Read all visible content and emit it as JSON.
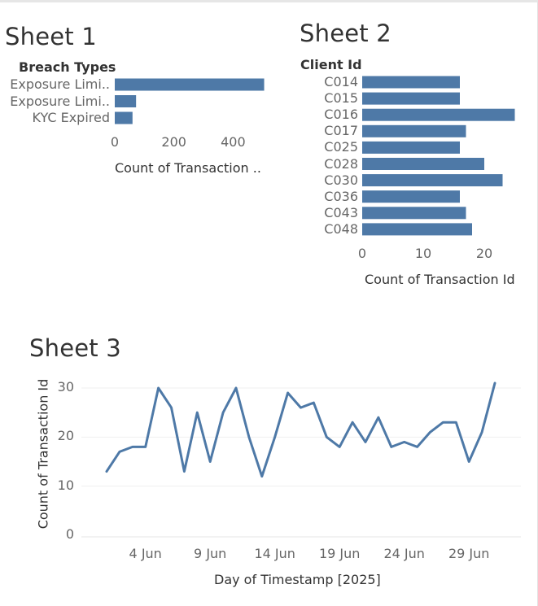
{
  "sheets": [
    {
      "title": "Sheet 1"
    },
    {
      "title": "Sheet 2"
    },
    {
      "title": "Sheet 3"
    }
  ],
  "colors": {
    "mark": "#4e79a7",
    "grid": "#efefef",
    "axis_text": "#666666",
    "title_text": "#333333"
  },
  "chart_data": [
    {
      "type": "bar",
      "orientation": "horizontal",
      "title": "Sheet 1",
      "row_header": "Breach Types",
      "categories": [
        "Exposure Limi..",
        "Exposure Limi..",
        "KYC Expired"
      ],
      "values": [
        505,
        72,
        60
      ],
      "xlabel": "Count of Transaction ..",
      "xticks": [
        "0",
        "200",
        "400"
      ],
      "xlim": [
        0,
        520
      ]
    },
    {
      "type": "bar",
      "orientation": "horizontal",
      "title": "Sheet 2",
      "row_header": "Client Id",
      "categories": [
        "C014",
        "C015",
        "C016",
        "C017",
        "C025",
        "C028",
        "C030",
        "C036",
        "C043",
        "C048"
      ],
      "values": [
        16,
        16,
        25,
        17,
        16,
        20,
        23,
        16,
        17,
        18
      ],
      "xlabel": "Count of Transaction Id",
      "xticks": [
        "0",
        "10",
        "20"
      ],
      "xlim": [
        0,
        26
      ]
    },
    {
      "type": "line",
      "title": "Sheet 3",
      "xlabel": "Day of Timestamp [2025]",
      "ylabel": "Count of Transaction Id",
      "yticks": [
        "0",
        "10",
        "20",
        "30"
      ],
      "ylim": [
        0,
        32
      ],
      "xticks": [
        {
          "label": "4 Jun",
          "day": 4
        },
        {
          "label": "9 Jun",
          "day": 9
        },
        {
          "label": "14 Jun",
          "day": 14
        },
        {
          "label": "19 Jun",
          "day": 19
        },
        {
          "label": "24 Jun",
          "day": 24
        },
        {
          "label": "29 Jun",
          "day": 29
        }
      ],
      "x": [
        "2025-06-01",
        "2025-06-02",
        "2025-06-03",
        "2025-06-04",
        "2025-06-05",
        "2025-06-06",
        "2025-06-07",
        "2025-06-08",
        "2025-06-09",
        "2025-06-10",
        "2025-06-11",
        "2025-06-12",
        "2025-06-13",
        "2025-06-14",
        "2025-06-15",
        "2025-06-16",
        "2025-06-17",
        "2025-06-18",
        "2025-06-19",
        "2025-06-20",
        "2025-06-21",
        "2025-06-22",
        "2025-06-23",
        "2025-06-24",
        "2025-06-25",
        "2025-06-26",
        "2025-06-27",
        "2025-06-28",
        "2025-06-29",
        "2025-06-30",
        "2025-07-01"
      ],
      "values": [
        13,
        17,
        18,
        18,
        30,
        26,
        13,
        25,
        15,
        25,
        30,
        20,
        12,
        20,
        29,
        26,
        27,
        20,
        18,
        23,
        19,
        24,
        18,
        19,
        18,
        21,
        23,
        23,
        15,
        21,
        31
      ],
      "grid": true
    }
  ]
}
